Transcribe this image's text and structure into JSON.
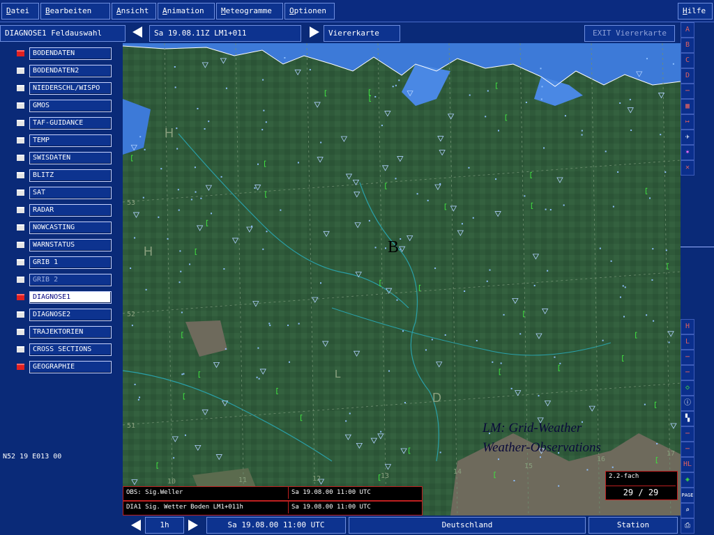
{
  "menu": [
    {
      "key": "D",
      "rest": "atei"
    },
    {
      "key": "B",
      "rest": "earbeiten"
    },
    {
      "key": "A",
      "rest": "nsicht"
    },
    {
      "key": "A",
      "rest": "nimation"
    },
    {
      "key": "M",
      "rest": "eteogramme"
    },
    {
      "key": "O",
      "rest": "ptionen"
    }
  ],
  "help": {
    "key": "H",
    "rest": "ilfe"
  },
  "toolbar": {
    "field_select": "DIAGNOSE1 Feldauswahl",
    "datetime": "Sa 19.08.11Z LM1+011",
    "view": "Viererkarte",
    "exit": "EXIT Viererkarte"
  },
  "sidebar": {
    "items": [
      {
        "label": "BODENDATEN",
        "checked": true
      },
      {
        "label": "BODENDATEN2",
        "checked": false
      },
      {
        "label": "NIEDERSCHL/WISPO",
        "checked": false
      },
      {
        "label": "GMOS",
        "checked": false
      },
      {
        "label": "TAF-GUIDANCE",
        "checked": false
      },
      {
        "label": "TEMP",
        "checked": false
      },
      {
        "label": "SWISDATEN",
        "checked": false
      },
      {
        "label": "BLITZ",
        "checked": false
      },
      {
        "label": "SAT",
        "checked": false
      },
      {
        "label": "RADAR",
        "checked": false
      },
      {
        "label": "NOWCASTING",
        "checked": false
      },
      {
        "label": "WARNSTATUS",
        "checked": false
      },
      {
        "label": "GRIB 1",
        "checked": false
      },
      {
        "label": "GRIB 2",
        "checked": false
      },
      {
        "label": "DIAGNOSE1",
        "checked": true
      },
      {
        "label": "DIAGNOSE2",
        "checked": false
      },
      {
        "label": "TRAJEKTORIEN",
        "checked": false
      },
      {
        "label": "CROSS SECTIONS",
        "checked": false
      },
      {
        "label": "GEOGRAPHIE",
        "checked": true
      }
    ],
    "coords": "N52 19 E013 00"
  },
  "map": {
    "labels": {
      "b": "B",
      "h1": "H",
      "h2": "H",
      "d": "D",
      "l": "L"
    },
    "lat": [
      "53",
      "52",
      "51"
    ],
    "lon": [
      "10",
      "11",
      "12",
      "13",
      "14",
      "15",
      "16",
      "17"
    ],
    "legend_line1": "LM: Grid-Weather",
    "legend_line2": "Weather-Observations",
    "zoom": "2.2-fach",
    "frame": "29 / 29"
  },
  "info": {
    "row1_left": "OBS: Sig.Weller",
    "row1_right": "Sa 19.08.00 11:00 UTC",
    "row2_left": "DIA1 Sig. Wetter Boden LM1+011h",
    "row2_right": "Sa 19.08.00 11:00 UTC"
  },
  "bottom": {
    "step": "1h",
    "time": "Sa 19.08.00 11:00 UTC",
    "region": "Deutschland",
    "station": "Station"
  },
  "rightstrip": {
    "letters": [
      "A",
      "B",
      "C",
      "D"
    ],
    "page": "PAGE"
  },
  "colors": {
    "land": "#2f5a3a",
    "sea": "#3d7ad8",
    "ui_blue": "#0a2a78",
    "accent_red": "#e02020"
  }
}
